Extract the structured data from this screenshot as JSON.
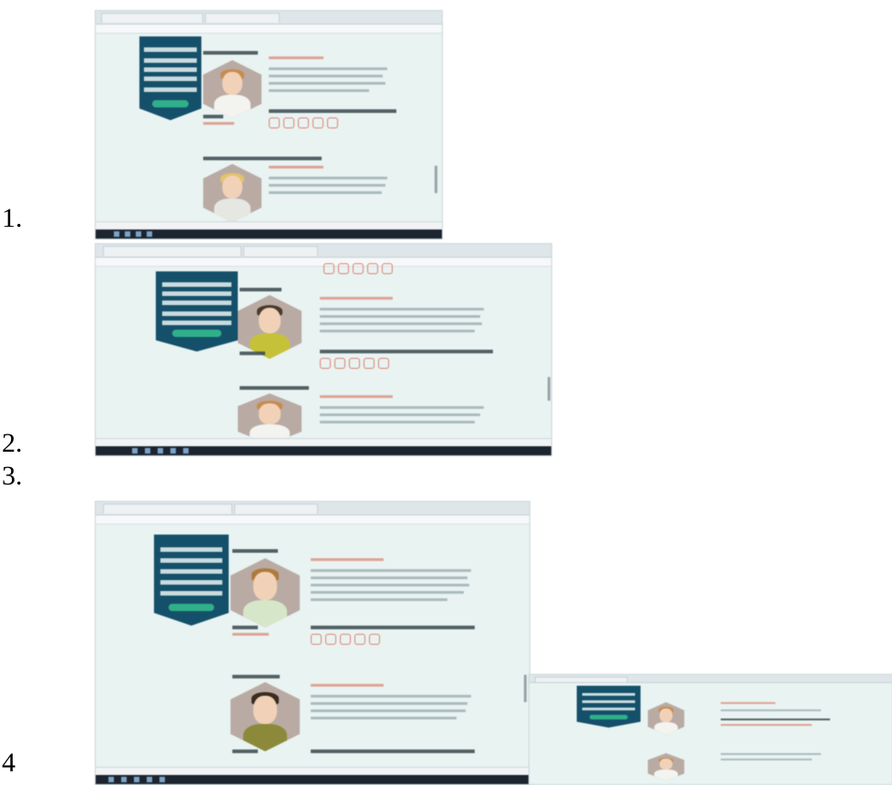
{
  "labels": {
    "one": "1.",
    "two": "2.",
    "three": "3.",
    "four": "4"
  },
  "colors": {
    "panel": "#15506a",
    "accent_button": "#2fb08a",
    "accent_icons": "#d9806e",
    "background": "#e9f3f2",
    "taskbar": "#1c2430"
  }
}
